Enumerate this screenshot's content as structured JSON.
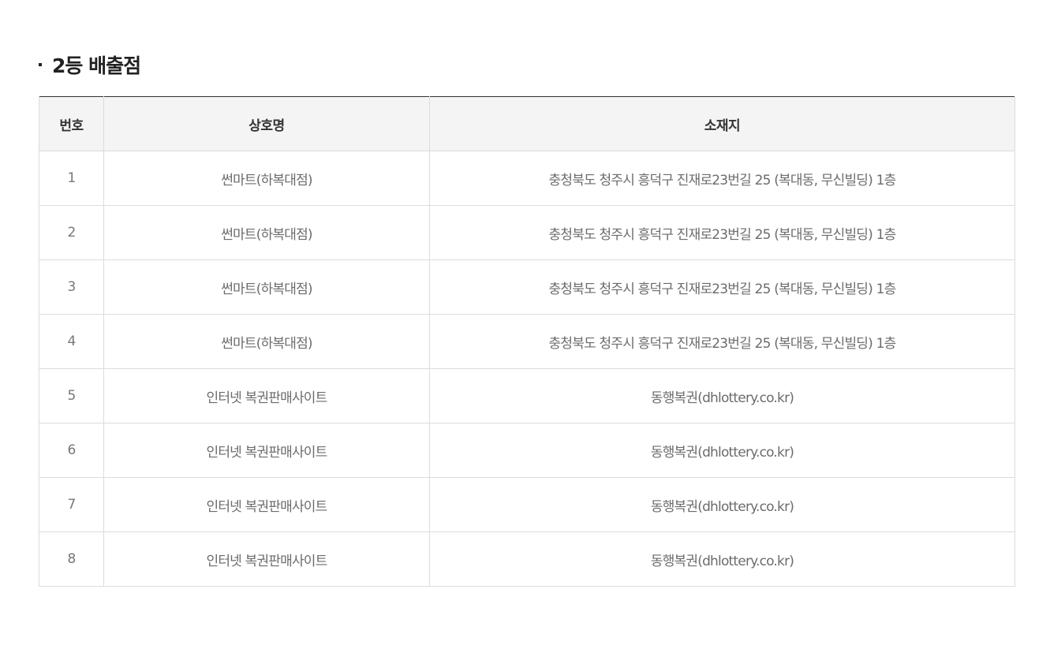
{
  "section": {
    "title": "2등 배출점"
  },
  "table": {
    "headers": {
      "no": "번호",
      "name": "상호명",
      "address": "소재지"
    },
    "rows": [
      {
        "no": "1",
        "name": "썬마트(하복대점)",
        "address": "충청북도 청주시 흥덕구 진재로23번길 25 (복대동, 무신빌딩) 1층"
      },
      {
        "no": "2",
        "name": "썬마트(하복대점)",
        "address": "충청북도 청주시 흥덕구 진재로23번길 25 (복대동, 무신빌딩) 1층"
      },
      {
        "no": "3",
        "name": "썬마트(하복대점)",
        "address": "충청북도 청주시 흥덕구 진재로23번길 25 (복대동, 무신빌딩) 1층"
      },
      {
        "no": "4",
        "name": "썬마트(하복대점)",
        "address": "충청북도 청주시 흥덕구 진재로23번길 25 (복대동, 무신빌딩) 1층"
      },
      {
        "no": "5",
        "name": "인터넷 복권판매사이트",
        "address": "동행복권(dhlottery.co.kr)"
      },
      {
        "no": "6",
        "name": "인터넷 복권판매사이트",
        "address": "동행복권(dhlottery.co.kr)"
      },
      {
        "no": "7",
        "name": "인터넷 복권판매사이트",
        "address": "동행복권(dhlottery.co.kr)"
      },
      {
        "no": "8",
        "name": "인터넷 복권판매사이트",
        "address": "동행복권(dhlottery.co.kr)"
      }
    ]
  }
}
